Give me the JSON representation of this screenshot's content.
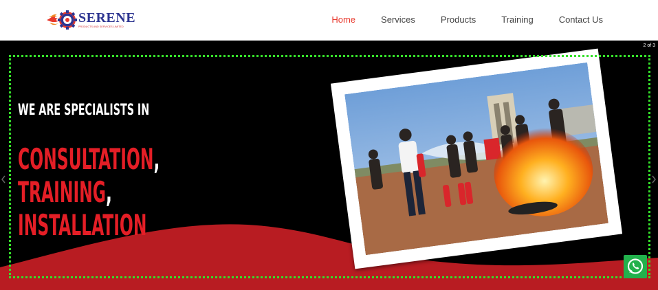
{
  "logo": {
    "name": "SERENE",
    "tagline": "PRODUCTS AND SERVICES LIMITED",
    "icon": "gear-flame-icon"
  },
  "nav": {
    "items": [
      {
        "label": "Home",
        "active": true
      },
      {
        "label": "Services",
        "active": false
      },
      {
        "label": "Products",
        "active": false
      },
      {
        "label": "Training",
        "active": false
      },
      {
        "label": "Contact Us",
        "active": false
      }
    ]
  },
  "hero": {
    "slide_counter": "2 of 3",
    "headline": "WE ARE SPECIALISTS IN",
    "specialties": [
      {
        "word": "CONSULTATION",
        "punct": ","
      },
      {
        "word": "TRAINING",
        "punct": ","
      },
      {
        "word": "INSTALLATION",
        "punct": ""
      }
    ],
    "photo_subject": "fire-extinguisher-training-photo",
    "prev_icon": "chevron-left-icon",
    "next_icon": "chevron-right-icon"
  },
  "whatsapp": {
    "icon": "whatsapp-icon"
  },
  "colors": {
    "accent_red": "#e41e26",
    "nav_active": "#e8392d",
    "wave_red": "#b81c22",
    "logo_blue": "#2d3591",
    "focus_outline": "#35e02a",
    "whatsapp_green": "#22b14c"
  }
}
